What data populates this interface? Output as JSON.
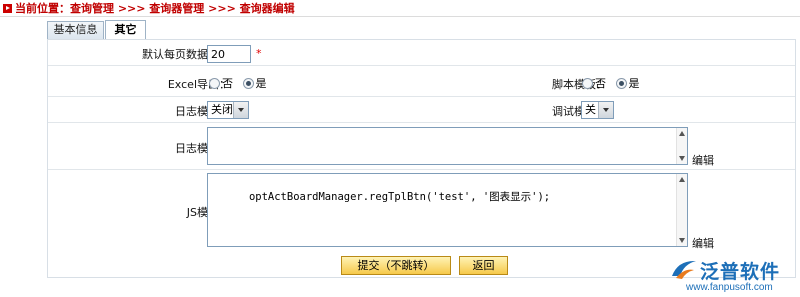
{
  "breadcrumb": {
    "text": "当前位置：查询管理 >>> 查询器管理 >>> 查询器编辑"
  },
  "tabs": [
    {
      "label": "基本信息",
      "active": false
    },
    {
      "label": "其它",
      "active": true
    }
  ],
  "form": {
    "rows_per_page": {
      "label": "默认每页数据行：",
      "value": "20",
      "required_mark": "*"
    },
    "excel_export": {
      "label": "Excel导出：",
      "options": [
        "否",
        "是"
      ],
      "selected": "是"
    },
    "script_template": {
      "label": "脚本模板：",
      "options": [
        "否",
        "是"
      ],
      "selected": "是"
    },
    "log_mode": {
      "label": "日志模式：",
      "value": "关闭"
    },
    "debug_mode": {
      "label": "调试模式：",
      "value": "关"
    },
    "log_template": {
      "label": "日志模板：",
      "value": "",
      "edit_label": "编辑"
    },
    "js_template": {
      "label": "JS模板：",
      "value": "optActBoardManager.regTplBtn('test', '图表显示');",
      "edit_label": "编辑"
    }
  },
  "buttons": {
    "submit": "提交（不跳转）",
    "back": "返回"
  },
  "branding": {
    "name": "泛普软件",
    "url": "www.fanpusoft.com",
    "color": "#1d6fb8"
  },
  "colors": {
    "breadcrumb": "#c00000",
    "required": "#e00000"
  }
}
